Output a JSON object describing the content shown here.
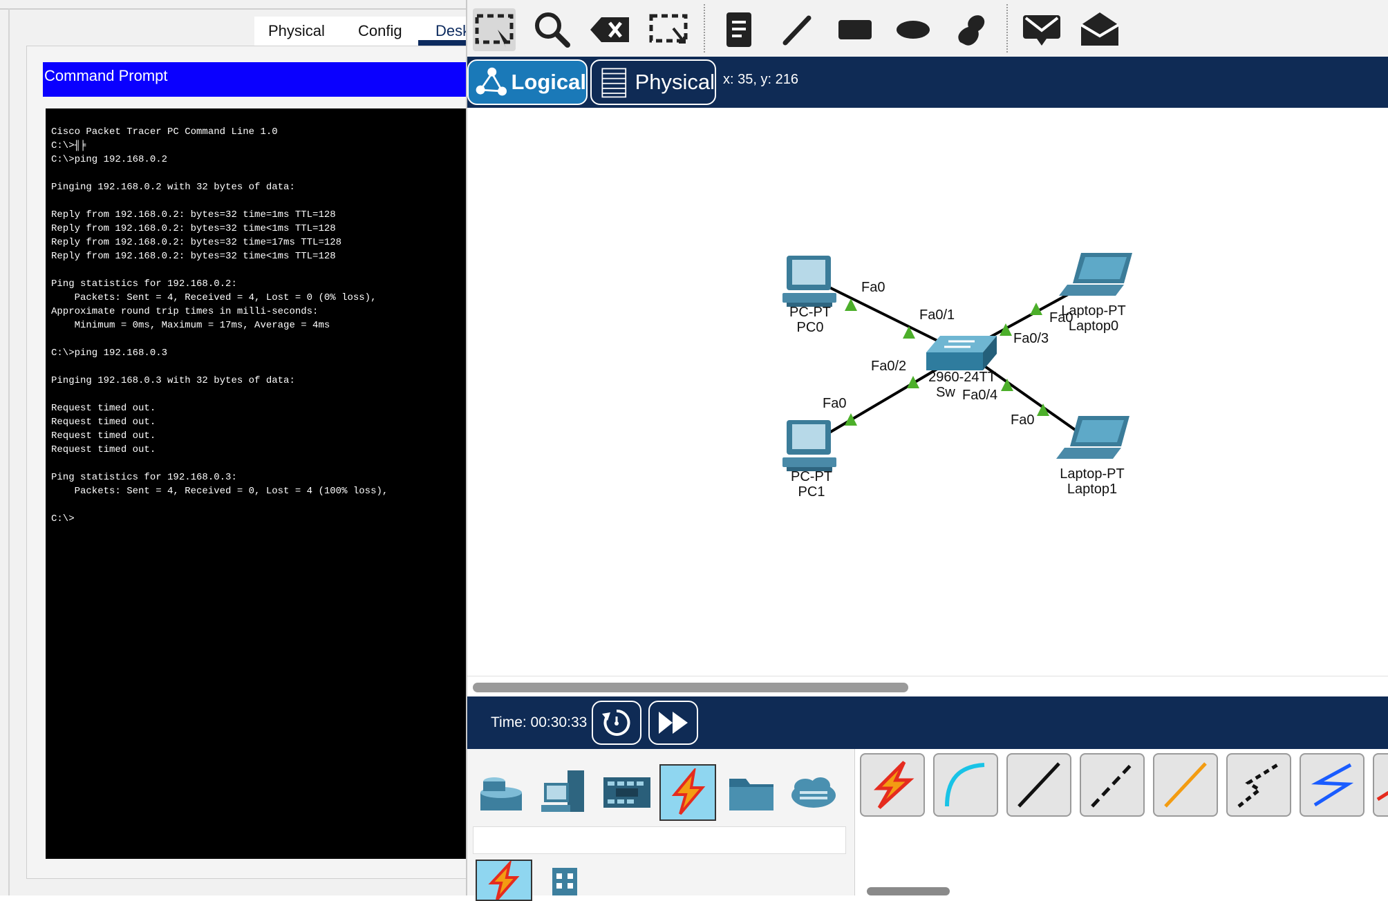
{
  "pc_window": {
    "tabs": [
      {
        "label": "Physical"
      },
      {
        "label": "Config"
      },
      {
        "label": "Desk"
      }
    ],
    "command_prompt_title": "Command Prompt",
    "terminal_lines": [
      "Cisco Packet Tracer PC Command Line 1.0",
      "C:\\>╢╞",
      "C:\\>ping 192.168.0.2",
      "",
      "Pinging 192.168.0.2 with 32 bytes of data:",
      "",
      "Reply from 192.168.0.2: bytes=32 time=1ms TTL=128",
      "Reply from 192.168.0.2: bytes=32 time<1ms TTL=128",
      "Reply from 192.168.0.2: bytes=32 time=17ms TTL=128",
      "Reply from 192.168.0.2: bytes=32 time<1ms TTL=128",
      "",
      "Ping statistics for 192.168.0.2:",
      "    Packets: Sent = 4, Received = 4, Lost = 0 (0% loss),",
      "Approximate round trip times in milli-seconds:",
      "    Minimum = 0ms, Maximum = 17ms, Average = 4ms",
      "",
      "C:\\>ping 192.168.0.3",
      "",
      "Pinging 192.168.0.3 with 32 bytes of data:",
      "",
      "Request timed out.",
      "Request timed out.",
      "Request timed out.",
      "Request timed out.",
      "",
      "Ping statistics for 192.168.0.3:",
      "    Packets: Sent = 4, Received = 0, Lost = 4 (100% loss),",
      "",
      "C:\\>"
    ]
  },
  "packet_tracer": {
    "toolbar": [
      {
        "name": "select-icon"
      },
      {
        "name": "inspect-icon"
      },
      {
        "name": "delete-icon"
      },
      {
        "name": "resize-icon"
      },
      {
        "name": "note-icon"
      },
      {
        "name": "draw-line-icon"
      },
      {
        "name": "rectangle-icon"
      },
      {
        "name": "ellipse-icon"
      },
      {
        "name": "freeform-icon"
      },
      {
        "name": "simple-pdu-icon"
      },
      {
        "name": "complex-pdu-icon"
      }
    ],
    "nav": {
      "logical_label": "Logical",
      "physical_label": "Physical",
      "coordinates": "x: 35, y: 216"
    },
    "topology": {
      "devices": [
        {
          "id": "pc0",
          "type": "pc",
          "model": "PC-PT",
          "name": "PC0"
        },
        {
          "id": "pc1",
          "type": "pc",
          "model": "PC-PT",
          "name": "PC1"
        },
        {
          "id": "laptop0",
          "type": "laptop",
          "model": "Laptop-PT",
          "name": "Laptop0"
        },
        {
          "id": "laptop1",
          "type": "laptop",
          "model": "Laptop-PT",
          "name": "Laptop1"
        },
        {
          "id": "switch0",
          "type": "switch",
          "model": "2960-24TT",
          "name": "Sw"
        }
      ],
      "links": [
        {
          "from": "pc0",
          "from_port": "Fa0",
          "to": "switch0",
          "to_port": "Fa0/1"
        },
        {
          "from": "pc1",
          "from_port": "Fa0",
          "to": "switch0",
          "to_port": "Fa0/2"
        },
        {
          "from": "laptop0",
          "from_port": "Fa0",
          "to": "switch0",
          "to_port": "Fa0/3"
        },
        {
          "from": "laptop1",
          "from_port": "Fa0",
          "to": "switch0",
          "to_port": "Fa0/4"
        }
      ]
    },
    "simulation": {
      "time": "Time: 00:30:33"
    },
    "device_categories": [
      {
        "name": "network-devices-icon",
        "selected": false
      },
      {
        "name": "end-devices-icon",
        "selected": false
      },
      {
        "name": "components-icon",
        "selected": false
      },
      {
        "name": "connections-icon",
        "selected": true
      },
      {
        "name": "miscellaneous-icon",
        "selected": false
      },
      {
        "name": "multiuser-icon",
        "selected": false
      }
    ],
    "cables": [
      {
        "name": "automatic-connection-icon",
        "color": "#e52b1e"
      },
      {
        "name": "console-cable-icon",
        "color": "#19c3e6"
      },
      {
        "name": "copper-straight-through-icon",
        "color": "#111111"
      },
      {
        "name": "copper-cross-over-icon",
        "color": "#111111"
      },
      {
        "name": "fiber-cable-icon",
        "color": "#f39c12"
      },
      {
        "name": "phone-cable-icon",
        "color": "#111111"
      },
      {
        "name": "coaxial-cable-icon",
        "color": "#1a5cff"
      }
    ]
  }
}
